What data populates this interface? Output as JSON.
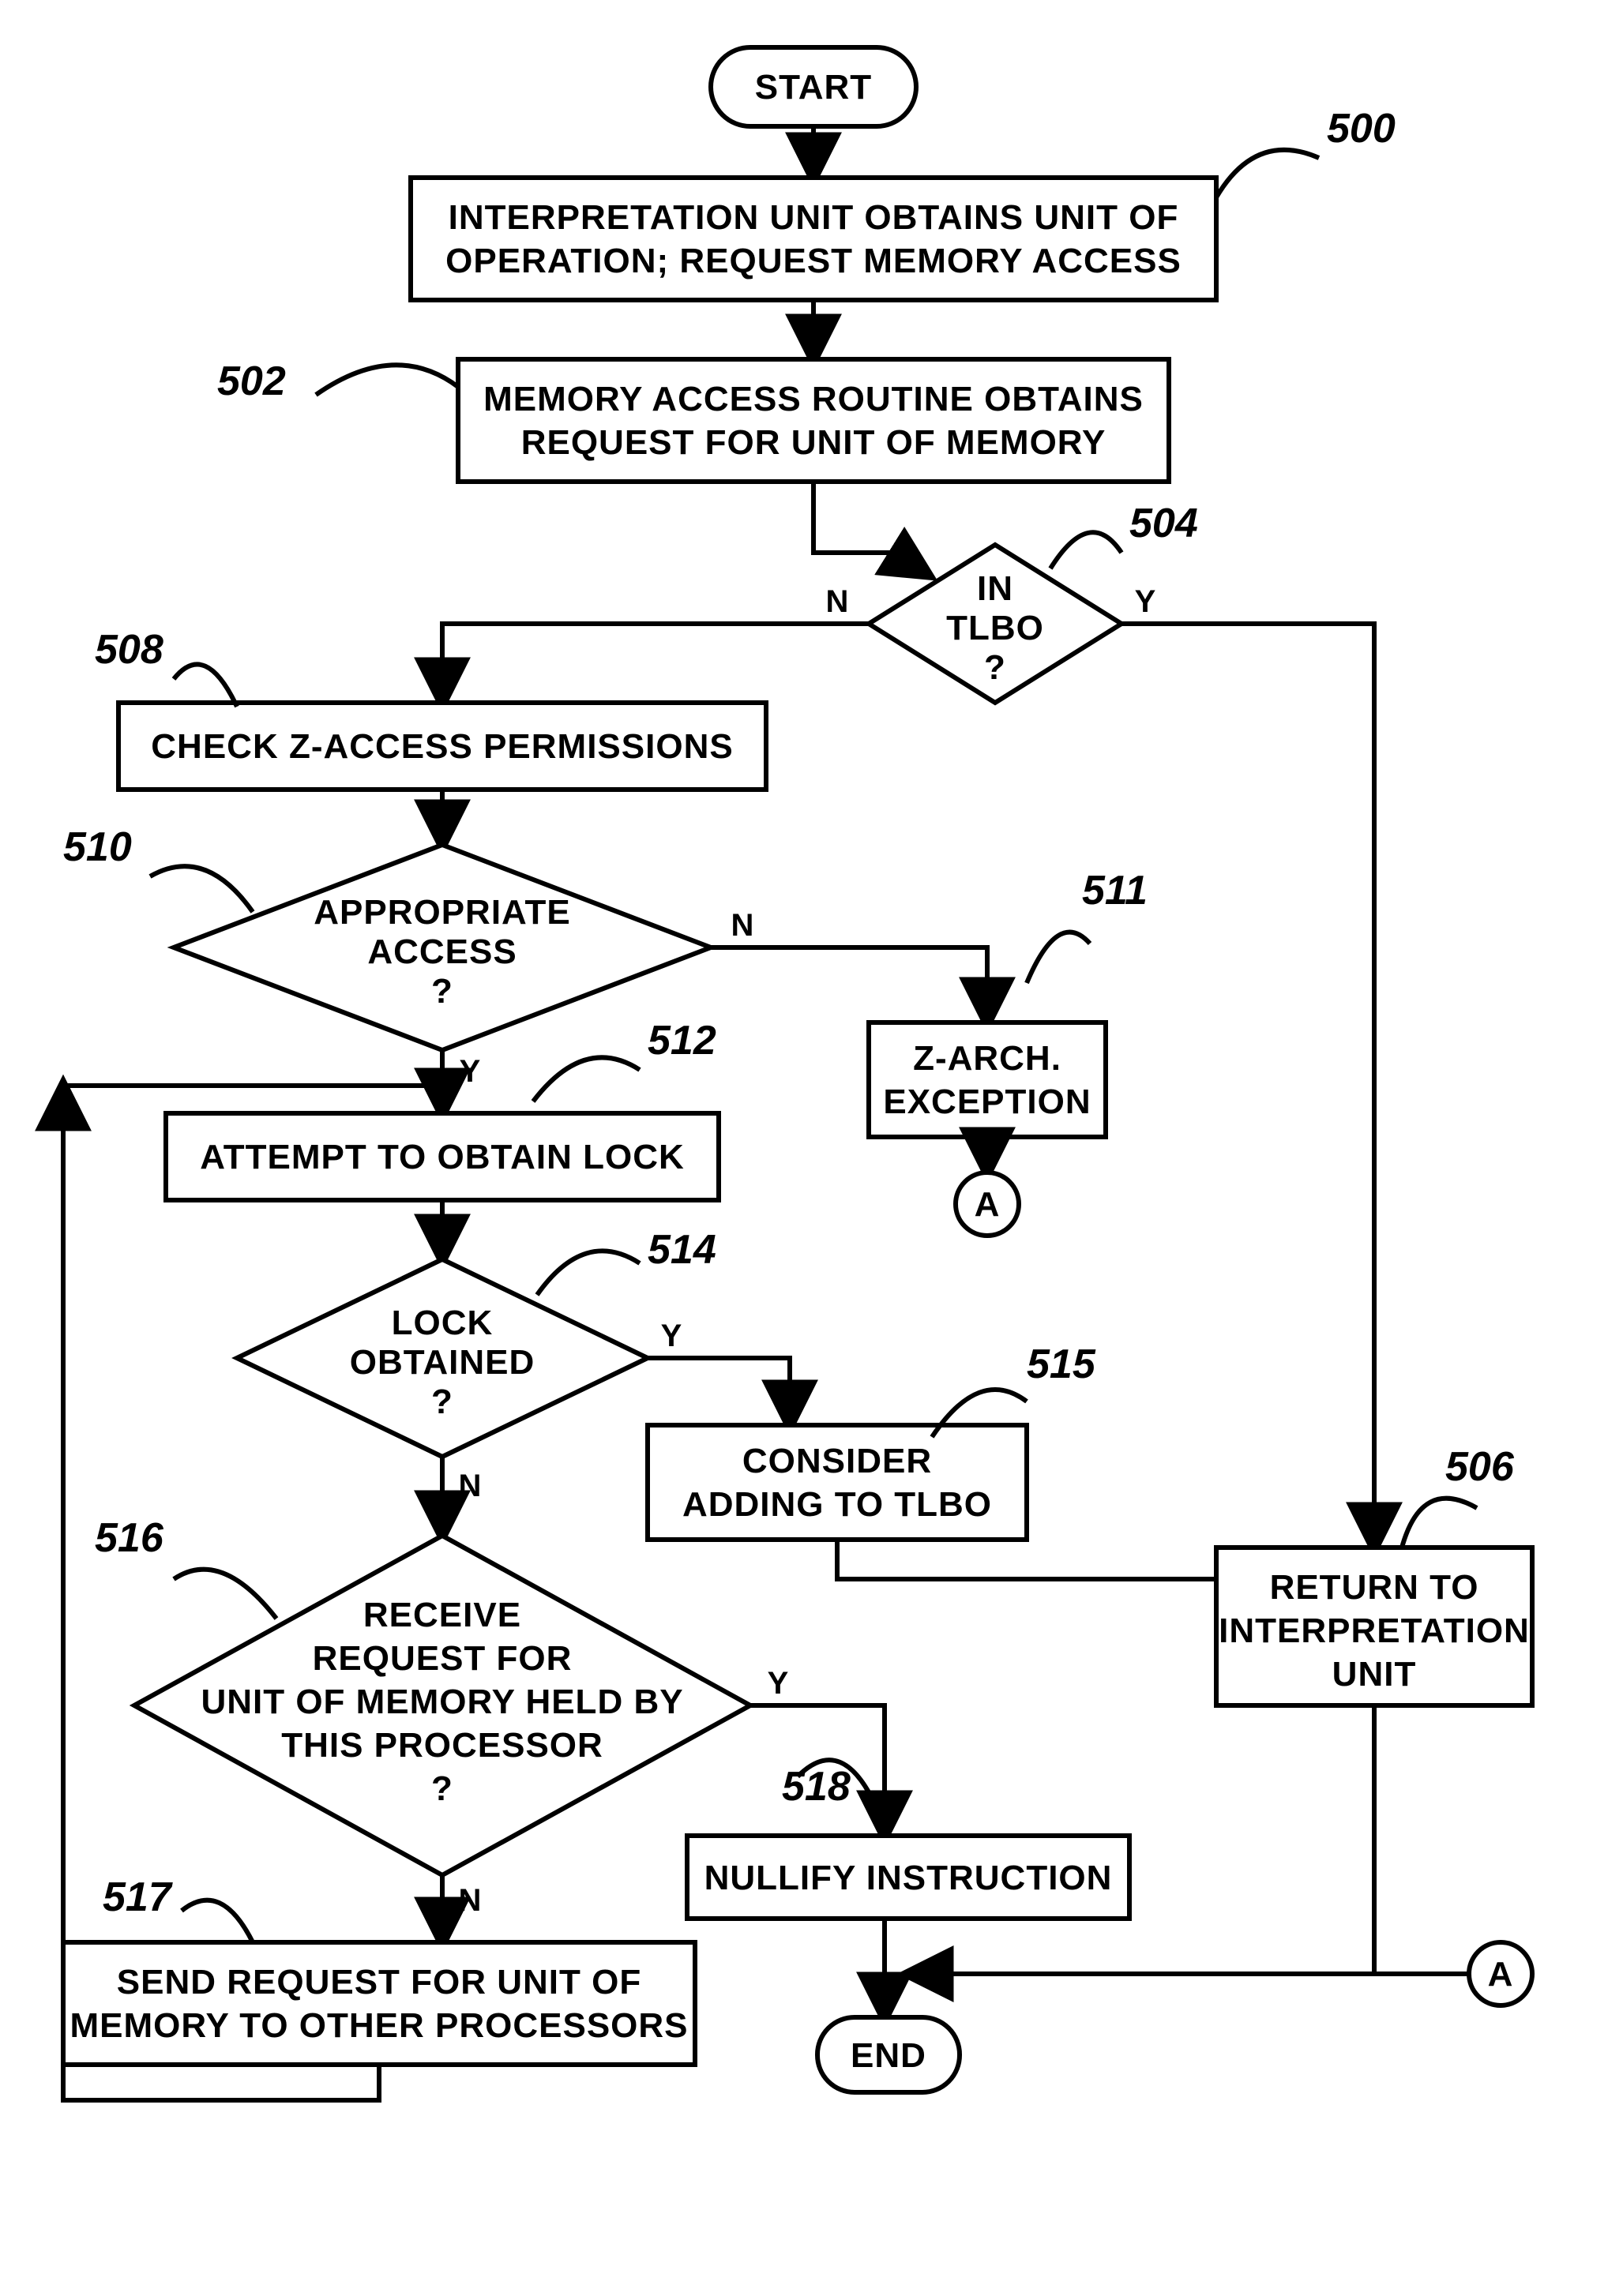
{
  "chart_data": {
    "type": "flowchart",
    "nodes": [
      {
        "id": "start",
        "kind": "terminator",
        "label": "START"
      },
      {
        "id": "500",
        "kind": "process",
        "ref": "500",
        "label": "INTERPRETATION UNIT OBTAINS UNIT OF OPERATION; REQUEST MEMORY ACCESS"
      },
      {
        "id": "502",
        "kind": "process",
        "ref": "502",
        "label": "MEMORY ACCESS ROUTINE OBTAINS REQUEST FOR UNIT OF MEMORY"
      },
      {
        "id": "504",
        "kind": "decision",
        "ref": "504",
        "label": "IN TLBO ?"
      },
      {
        "id": "508",
        "kind": "process",
        "ref": "508",
        "label": "CHECK Z-ACCESS PERMISSIONS"
      },
      {
        "id": "510",
        "kind": "decision",
        "ref": "510",
        "label": "APPROPRIATE ACCESS ?"
      },
      {
        "id": "511",
        "kind": "process",
        "ref": "511",
        "label": "Z-ARCH. EXCEPTION"
      },
      {
        "id": "A1",
        "kind": "connector",
        "label": "A"
      },
      {
        "id": "512",
        "kind": "process",
        "ref": "512",
        "label": "ATTEMPT TO OBTAIN LOCK"
      },
      {
        "id": "514",
        "kind": "decision",
        "ref": "514",
        "label": "LOCK OBTAINED ?"
      },
      {
        "id": "515",
        "kind": "process",
        "ref": "515",
        "label": "CONSIDER ADDING TO TLBO"
      },
      {
        "id": "506",
        "kind": "process",
        "ref": "506",
        "label": "RETURN TO INTERPRETATION UNIT"
      },
      {
        "id": "516",
        "kind": "decision",
        "ref": "516",
        "label": "RECEIVE REQUEST FOR UNIT OF MEMORY HELD BY THIS PROCESSOR ?"
      },
      {
        "id": "517",
        "kind": "process",
        "ref": "517",
        "label": "SEND REQUEST FOR UNIT OF MEMORY TO OTHER PROCESSORS"
      },
      {
        "id": "518",
        "kind": "process",
        "ref": "518",
        "label": "NULLIFY INSTRUCTION"
      },
      {
        "id": "A2",
        "kind": "connector",
        "label": "A"
      },
      {
        "id": "end",
        "kind": "terminator",
        "label": "END"
      }
    ],
    "edges": [
      {
        "from": "start",
        "to": "500"
      },
      {
        "from": "500",
        "to": "502"
      },
      {
        "from": "502",
        "to": "504"
      },
      {
        "from": "504",
        "to": "506",
        "label": "Y"
      },
      {
        "from": "504",
        "to": "508",
        "label": "N"
      },
      {
        "from": "508",
        "to": "510"
      },
      {
        "from": "510",
        "to": "511",
        "label": "N"
      },
      {
        "from": "511",
        "to": "A1"
      },
      {
        "from": "510",
        "to": "512",
        "label": "Y"
      },
      {
        "from": "512",
        "to": "514"
      },
      {
        "from": "514",
        "to": "515",
        "label": "Y"
      },
      {
        "from": "515",
        "to": "506"
      },
      {
        "from": "514",
        "to": "516",
        "label": "N"
      },
      {
        "from": "516",
        "to": "518",
        "label": "Y"
      },
      {
        "from": "516",
        "to": "517",
        "label": "N"
      },
      {
        "from": "517",
        "to": "512",
        "note": "loop back"
      },
      {
        "from": "518",
        "to": "end"
      },
      {
        "from": "506",
        "to": "end",
        "via": "A2->518 merge line"
      },
      {
        "from": "A2",
        "to": "end",
        "note": "off-page connector merges into END via 518 path"
      }
    ]
  },
  "labels": {
    "start": "START",
    "end": "END",
    "A": "A",
    "Y": "Y",
    "N": "N",
    "n500_l1": "INTERPRETATION UNIT OBTAINS UNIT OF",
    "n500_l2": "OPERATION; REQUEST MEMORY ACCESS",
    "n502_l1": "MEMORY ACCESS ROUTINE OBTAINS",
    "n502_l2": "REQUEST FOR UNIT OF MEMORY",
    "n504_l1": "IN",
    "n504_l2": "TLBO",
    "n504_l3": "?",
    "n508": "CHECK Z-ACCESS PERMISSIONS",
    "n510_l1": "APPROPRIATE",
    "n510_l2": "ACCESS",
    "n510_l3": "?",
    "n511_l1": "Z-ARCH.",
    "n511_l2": "EXCEPTION",
    "n512": "ATTEMPT TO OBTAIN LOCK",
    "n514_l1": "LOCK",
    "n514_l2": "OBTAINED",
    "n514_l3": "?",
    "n515_l1": "CONSIDER",
    "n515_l2": "ADDING TO TLBO",
    "n506_l1": "RETURN TO",
    "n506_l2": "INTERPRETATION",
    "n506_l3": "UNIT",
    "n516_l1": "RECEIVE",
    "n516_l2": "REQUEST FOR",
    "n516_l3": "UNIT OF MEMORY HELD BY",
    "n516_l4": "THIS PROCESSOR",
    "n516_l5": "?",
    "n517_l1": "SEND REQUEST FOR UNIT OF",
    "n517_l2": "MEMORY TO OTHER PROCESSORS",
    "n518": "NULLIFY INSTRUCTION"
  },
  "refs": {
    "r500": "500",
    "r502": "502",
    "r504": "504",
    "r506": "506",
    "r508": "508",
    "r510": "510",
    "r511": "511",
    "r512": "512",
    "r514": "514",
    "r515": "515",
    "r516": "516",
    "r517": "517",
    "r518": "518"
  }
}
